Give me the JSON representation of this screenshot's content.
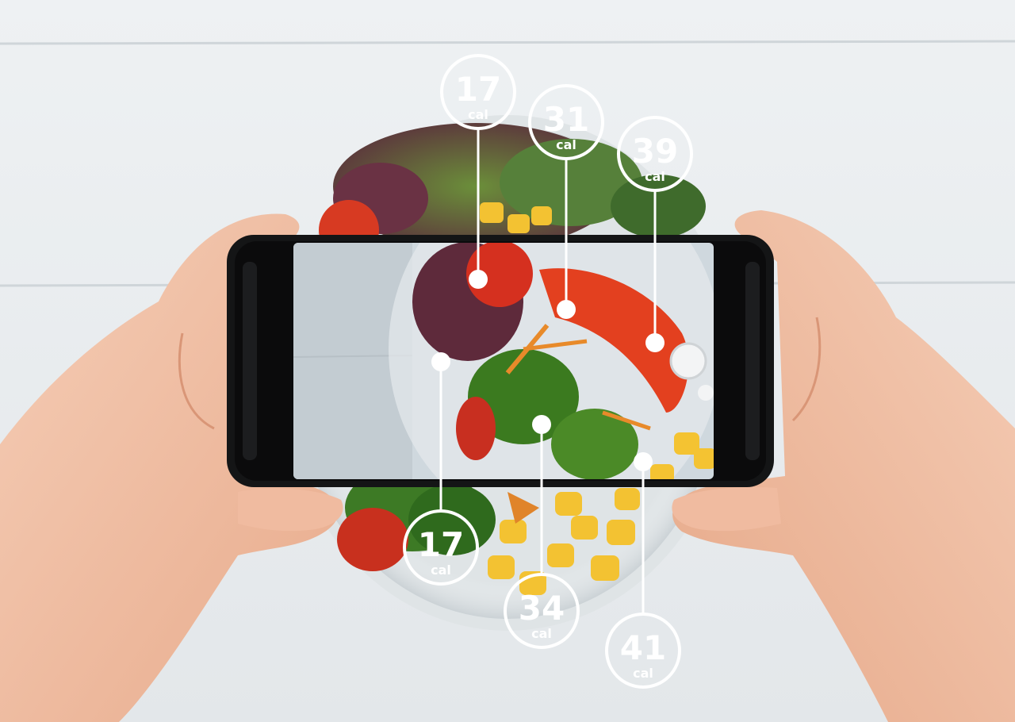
{
  "labels": [
    {
      "id": "tomato-top",
      "value": "17",
      "unit": "cal"
    },
    {
      "id": "onion",
      "value": "31",
      "unit": "cal"
    },
    {
      "id": "pepper",
      "value": "39",
      "unit": "cal"
    },
    {
      "id": "lettuce",
      "value": "17",
      "unit": "cal"
    },
    {
      "id": "broccoli",
      "value": "34",
      "unit": "cal"
    },
    {
      "id": "corn",
      "value": "41",
      "unit": "cal"
    }
  ]
}
